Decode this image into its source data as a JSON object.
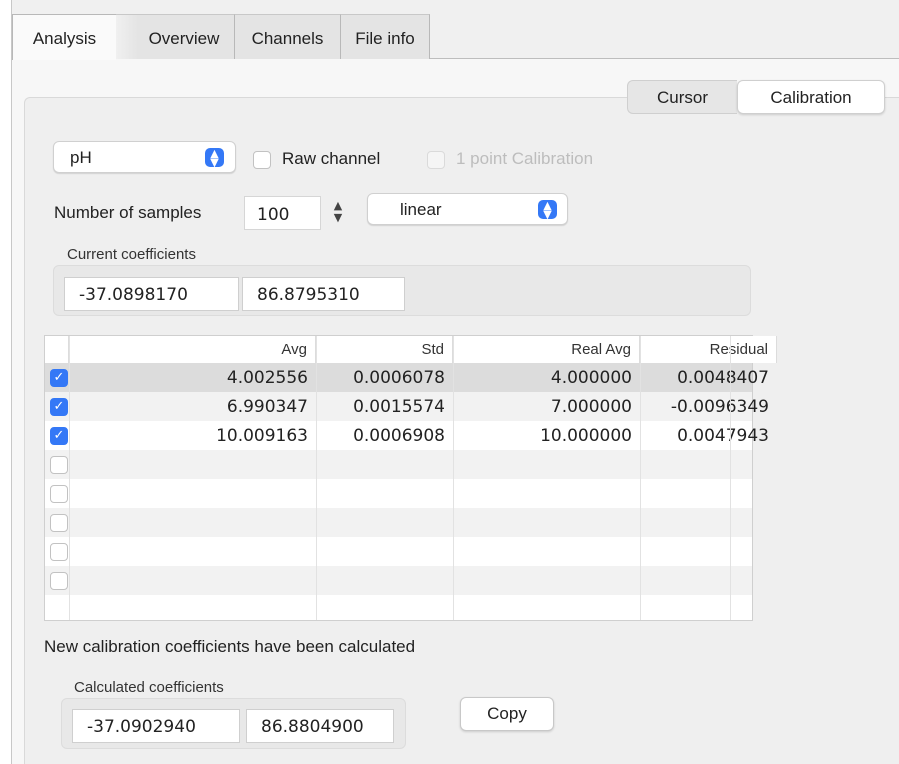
{
  "tabs": [
    {
      "label": "Analysis",
      "active": true
    },
    {
      "label": "Overview",
      "active": false
    },
    {
      "label": "Channels",
      "active": false
    },
    {
      "label": "File info",
      "active": false
    }
  ],
  "segmented": {
    "cursor": "Cursor",
    "calibration": "Calibration",
    "selected": "Calibration"
  },
  "channel_select": {
    "value": "pH"
  },
  "raw_channel": {
    "label": "Raw channel",
    "checked": false
  },
  "one_point": {
    "label": "1 point Calibration",
    "checked": false,
    "enabled": false
  },
  "samples": {
    "label": "Number of samples",
    "value": "100"
  },
  "fit_select": {
    "value": "linear"
  },
  "current_coeffs": {
    "title": "Current coefficients",
    "a": "-37.0898170",
    "b": "86.8795310"
  },
  "table": {
    "columns": [
      "Avg",
      "Std",
      "Real Avg",
      "Residual"
    ],
    "rows": [
      {
        "checked": true,
        "avg": "4.002556",
        "std": "0.0006078",
        "real_avg": "4.000000",
        "residual": "0.0048407"
      },
      {
        "checked": true,
        "avg": "6.990347",
        "std": "0.0015574",
        "real_avg": "7.000000",
        "residual": "-0.0096349"
      },
      {
        "checked": true,
        "avg": "10.009163",
        "std": "0.0006908",
        "real_avg": "10.000000",
        "residual": "0.0047943"
      },
      {
        "checked": false,
        "avg": "",
        "std": "",
        "real_avg": "",
        "residual": ""
      },
      {
        "checked": false,
        "avg": "",
        "std": "",
        "real_avg": "",
        "residual": ""
      },
      {
        "checked": false,
        "avg": "",
        "std": "",
        "real_avg": "",
        "residual": ""
      },
      {
        "checked": false,
        "avg": "",
        "std": "",
        "real_avg": "",
        "residual": ""
      },
      {
        "checked": false,
        "avg": "",
        "std": "",
        "real_avg": "",
        "residual": ""
      }
    ]
  },
  "status": "New calibration coefficients have been calculated",
  "calc_coeffs": {
    "title": "Calculated coefficients",
    "a": "-37.0902940",
    "b": "86.8804900"
  },
  "copy_button": "Copy",
  "colors": {
    "accent": "#3478f6"
  }
}
